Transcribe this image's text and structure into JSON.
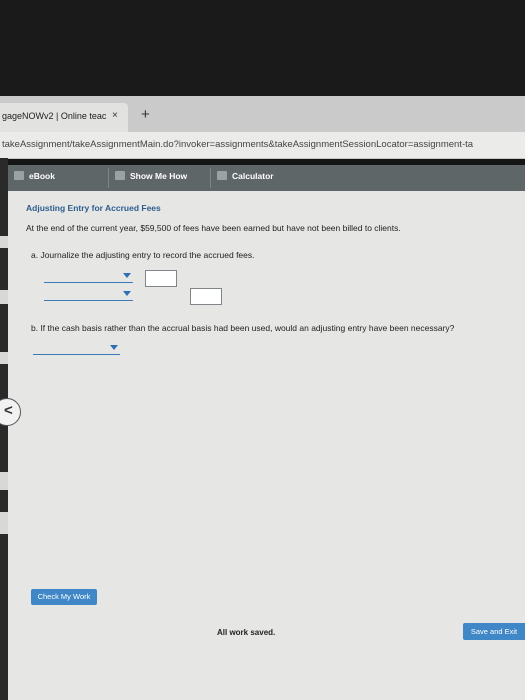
{
  "browser": {
    "tab_title": "gageNOWv2 | Online teac",
    "tab_close_glyph": "×",
    "new_tab_glyph": "+",
    "url": "takeAssignment/takeAssignmentMain.do?invoker=assignments&takeAssignmentSessionLocator=assignment-ta"
  },
  "toolbar": {
    "ebook_label": "eBook",
    "show_me_how_label": "Show Me How",
    "calculator_label": "Calculator"
  },
  "problem": {
    "heading": "Adjusting Entry for Accrued Fees",
    "statement": "At the end of the current year, $59,500 of fees have been earned but have not been billed to clients.",
    "part_a": "a.  Journalize the adjusting entry to record the accrued fees.",
    "part_b": "b.  If the cash basis rather than the accrual basis had been used, would an adjusting entry have been necessary?"
  },
  "nav": {
    "back_glyph": "<"
  },
  "footer": {
    "check_my_work_label": "Check My Work",
    "status_text": "All work saved.",
    "save_exit_label": "Save and Exit"
  },
  "colors": {
    "accent": "#3f87c6",
    "heading": "#2c5d8f",
    "toolbar": "#5f6668"
  }
}
